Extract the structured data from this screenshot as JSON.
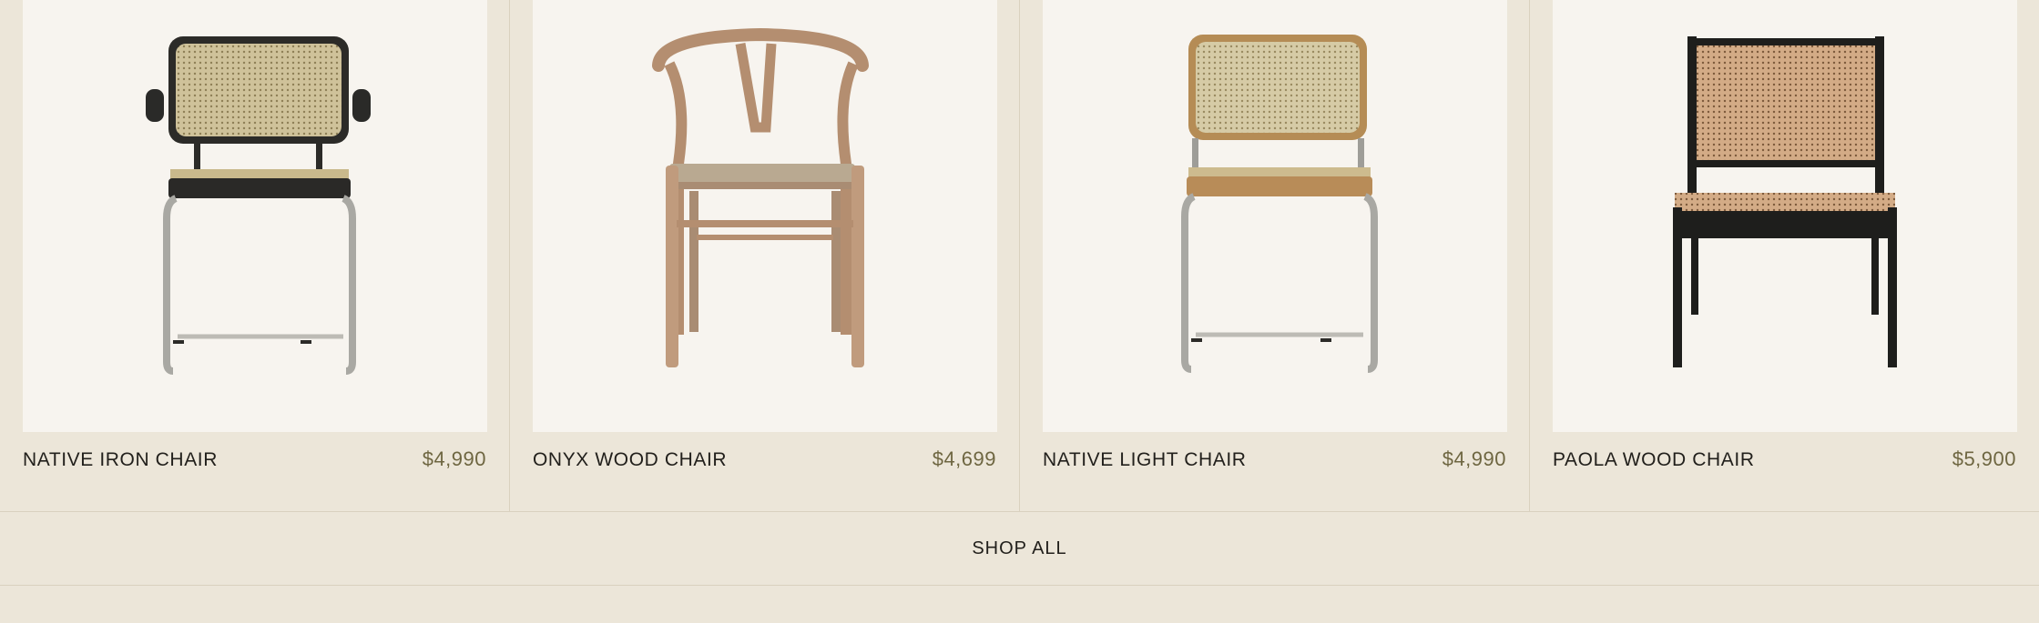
{
  "products": [
    {
      "name": "NATIVE IRON CHAIR",
      "price": "$4,990",
      "image": "chair-steel-cane-black-frame"
    },
    {
      "name": "ONYX WOOD CHAIR",
      "price": "$4,699",
      "image": "chair-wishbone-wood"
    },
    {
      "name": "NATIVE LIGHT CHAIR",
      "price": "$4,990",
      "image": "chair-steel-cane-light-frame"
    },
    {
      "name": "PAOLA WOOD CHAIR",
      "price": "$5,900",
      "image": "chair-lounge-black-cane"
    }
  ],
  "shop_all_label": "SHOP ALL",
  "colors": {
    "page_bg": "#ECE6D9",
    "card_bg": "#F7F4EF",
    "price": "#6E6641",
    "text": "#22201C",
    "divider": "#D9D1BF"
  }
}
